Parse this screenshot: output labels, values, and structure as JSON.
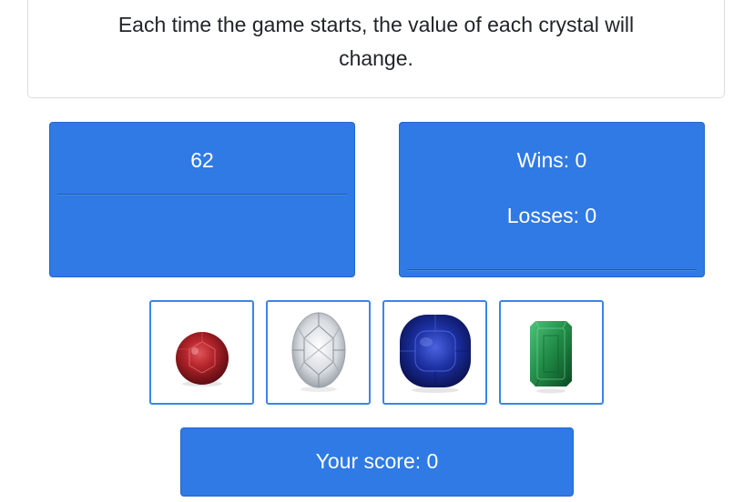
{
  "instructions": {
    "text": "Each time the game starts, the value of each crystal will change."
  },
  "target": {
    "number": "62"
  },
  "stats": {
    "wins_label": "Wins: 0",
    "losses_label": "Losses: 0"
  },
  "crystals": [
    {
      "name": "ruby",
      "icon": "red-round-gem-icon",
      "color": "#b3242a"
    },
    {
      "name": "diamond",
      "icon": "clear-oval-diamond-icon",
      "color": "#e8ecef"
    },
    {
      "name": "sapphire",
      "icon": "blue-cushion-gem-icon",
      "color": "#1b2fa0"
    },
    {
      "name": "emerald",
      "icon": "green-emerald-cut-gem-icon",
      "color": "#1f8a45"
    }
  ],
  "score": {
    "label": "Your score: 0"
  },
  "colors": {
    "panel": "#2f7ae5",
    "panel_border": "#2567c9",
    "crystal_border": "#3a85ea"
  }
}
